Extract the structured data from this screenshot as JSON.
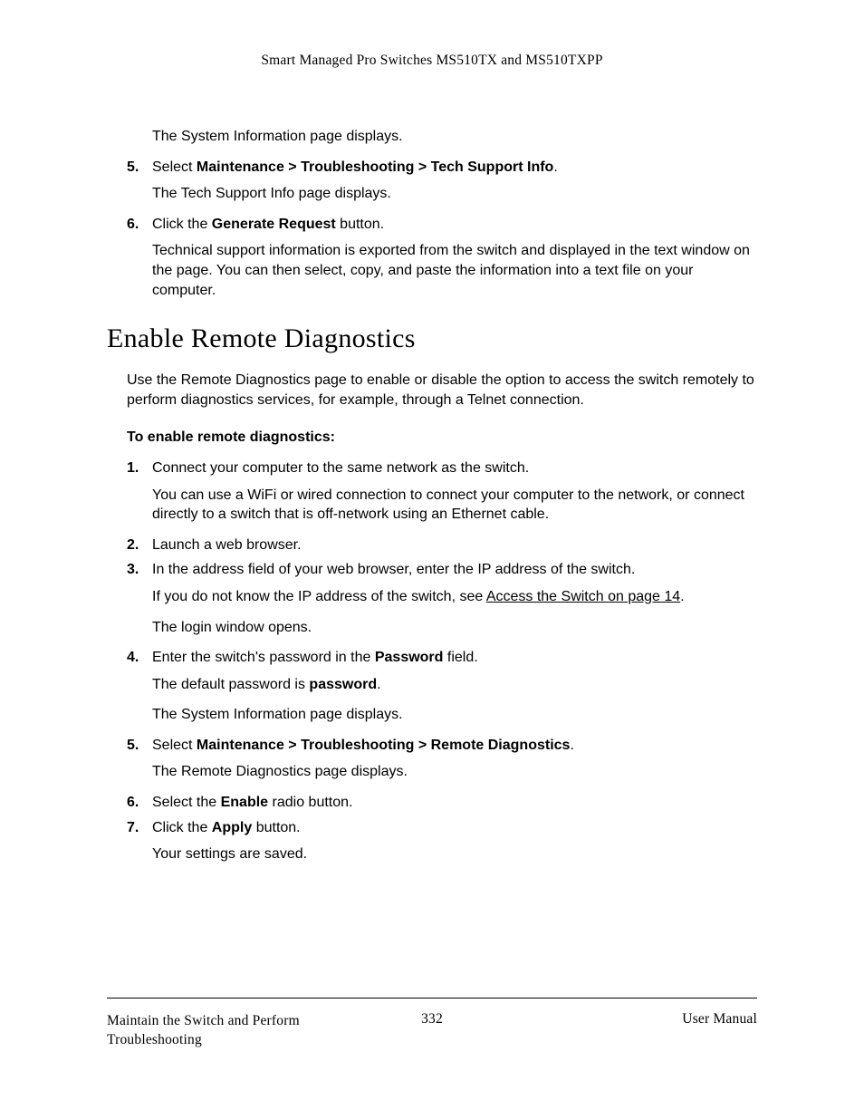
{
  "header": "Smart Managed Pro Switches MS510TX and MS510TXPP",
  "top_sub_1": "The System Information page displays.",
  "top_item5_num": "5.",
  "top_item5_pre": "Select ",
  "top_item5_bold": "Maintenance > Troubleshooting > Tech Support Info",
  "top_item5_post": ".",
  "top_item5_sub": "The Tech Support Info page displays.",
  "top_item6_num": "6.",
  "top_item6_pre": "Click the ",
  "top_item6_bold": "Generate Request",
  "top_item6_post": " button.",
  "top_item6_sub": "Technical support information is exported from the switch and displayed in the text window on the page. You can then select, copy, and paste the information into a text file on your computer.",
  "section_title": "Enable Remote Diagnostics",
  "intro": "Use the Remote Diagnostics page to enable or disable the option to access the switch remotely to perform diagnostics services, for example, through a Telnet connection.",
  "lead": "To enable remote diagnostics:",
  "s1_num": "1.",
  "s1_text": "Connect your computer to the same network as the switch.",
  "s1_sub": "You can use a WiFi or wired connection to connect your computer to the network, or connect directly to a switch that is off-network using an Ethernet cable.",
  "s2_num": "2.",
  "s2_text": "Launch a web browser.",
  "s3_num": "3.",
  "s3_text": "In the address field of your web browser, enter the IP address of the switch.",
  "s3_sub1_pre": "If you do not know the IP address of the switch, see ",
  "s3_sub1_link": "Access the Switch on page 14",
  "s3_sub1_post": ".",
  "s3_sub2": "The login window opens.",
  "s4_num": "4.",
  "s4_pre": "Enter the switch's password in the ",
  "s4_bold": "Password",
  "s4_post": " field.",
  "s4_sub1_pre": "The default password is ",
  "s4_sub1_bold": "password",
  "s4_sub1_post": ".",
  "s4_sub2": "The System Information page displays.",
  "s5_num": "5.",
  "s5_pre": "Select ",
  "s5_bold": "Maintenance > Troubleshooting > Remote Diagnostics",
  "s5_post": ".",
  "s5_sub": "The Remote Diagnostics page displays.",
  "s6_num": "6.",
  "s6_pre": "Select the ",
  "s6_bold": "Enable",
  "s6_post": " radio button.",
  "s7_num": "7.",
  "s7_pre": "Click the ",
  "s7_bold": "Apply",
  "s7_post": " button.",
  "s7_sub": "Your settings are saved.",
  "footer_left": "Maintain the Switch and Perform Troubleshooting",
  "footer_center": "332",
  "footer_right": "User Manual"
}
